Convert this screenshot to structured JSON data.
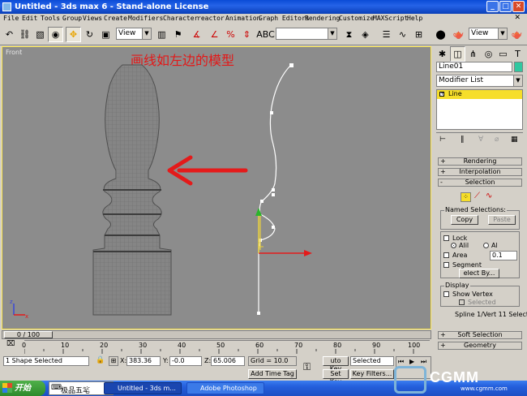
{
  "window": {
    "title": "Untitled - 3ds max 6 - Stand-alone License"
  },
  "menu": [
    "File",
    "Edit",
    "Tools",
    "Group",
    "Views",
    "Create",
    "Modifiers",
    "Character",
    "reactor",
    "Animation",
    "Graph Editors",
    "Rendering",
    "Customize",
    "MAXScript",
    "Help"
  ],
  "toolbar": {
    "view_combo_1": "View",
    "view_combo_2": "View",
    "selection_set": ""
  },
  "viewport": {
    "label": "Front",
    "annotation": "画线如左边的模型"
  },
  "command_panel": {
    "object_name": "Line01",
    "modifier_list": "Modifier List",
    "stack_item": "Line",
    "rollouts": {
      "rendering": "Rendering",
      "interpolation": "Interpolation",
      "selection": "Selection",
      "soft_selection": "Soft Selection",
      "geometry": "Geometry"
    },
    "named_selections": {
      "label": "Named Selections:",
      "copy": "Copy",
      "paste": "Paste"
    },
    "lock": "Lock",
    "alil": "Alil",
    "al": "Al",
    "area": "Area",
    "area_value": "0.1",
    "segment": "Segment",
    "select_by": "elect By...",
    "display": {
      "label": "Display",
      "show_vertex": "Show Vertex",
      "selected": "Selected"
    },
    "status_text": "Spline 1/Vert 11 Selected"
  },
  "timeline": {
    "frame": "0 / 100",
    "ticks": [
      "0",
      "10",
      "20",
      "30",
      "40",
      "50",
      "60",
      "70",
      "80",
      "90",
      "100"
    ]
  },
  "status_bar": {
    "selection": "1 Shape Selected",
    "x_label": "X:",
    "x_value": "383.36",
    "y_label": "Y:",
    "y_value": "-0.0",
    "z_label": "Z:",
    "z_value": "65.006",
    "grid": "Grid = 10.0",
    "add_time_tag": "Add Time Tag",
    "auto_key": "uto Key",
    "auto_key_sel": "Selected",
    "set_key": "Set Key",
    "key_filters": "Key Filters..."
  },
  "taskbar": {
    "start": "开始",
    "ime": "极品五笔",
    "ime_extra": "06",
    "tasks": [
      "Untitled - 3ds m...",
      "Adobe Photoshop"
    ],
    "watermark": "CGMM",
    "watermark_url": "www.cgmm.com"
  }
}
